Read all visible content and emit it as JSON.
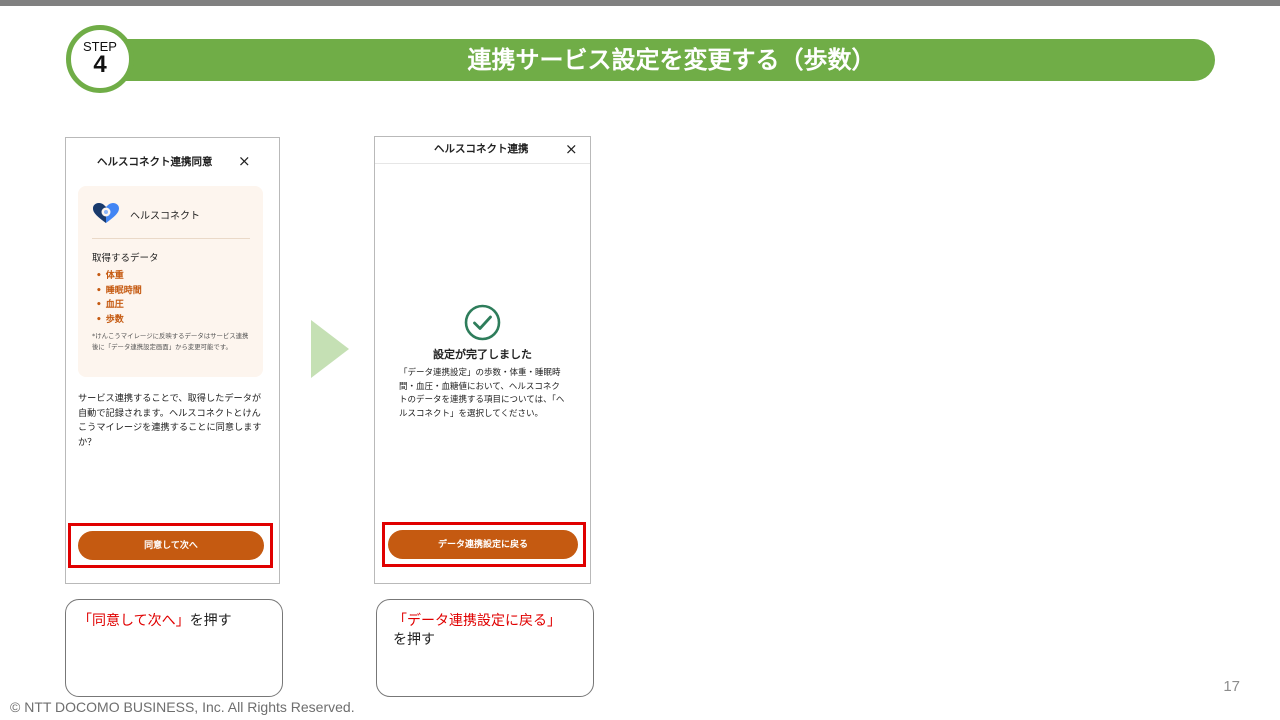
{
  "step": {
    "label": "STEP",
    "number": "4",
    "title": "連携サービス設定を変更する（歩数）"
  },
  "screen1": {
    "header_title": "ヘルスコネクト連携同意",
    "close": "×",
    "service_name": "ヘルスコネクト",
    "data_heading": "取得するデータ",
    "data_items": [
      "体重",
      "睡眠時間",
      "血圧",
      "歩数"
    ],
    "note": "*けんこうマイレージに反映するデータはサービス連携後に「データ連携設定画面」から変更可能です。",
    "description": "サービス連携することで、取得したデータが自動で記録されます。ヘルスコネクトとけんこうマイレージを連携することに同意しますか？",
    "button_label": "同意して次へ"
  },
  "screen2": {
    "header_title": "ヘルスコネクト連携",
    "close": "×",
    "done_title": "設定が完了しました",
    "description": "「データ連携設定」の歩数・体重・睡眠時間・血圧・血糖値において、ヘルスコネクトのデータを連携する項目については、「ヘルスコネクト」を選択してください。",
    "button_label": "データ連携設定に戻る"
  },
  "callouts": {
    "c1_red": "「同意して次へ」",
    "c1_black": "を押す",
    "c2_red": "「データ連携設定に戻る」",
    "c2_black": "を押す"
  },
  "footer": {
    "page_number": "17",
    "copyright": "© NTT DOCOMO BUSINESS, Inc. All Rights Reserved."
  },
  "colors": {
    "step_green": "#70ad47",
    "button_orange": "#c55a11",
    "highlight_red": "#e00000",
    "arrow_green": "#c5e0b4",
    "check_green": "#2e7d5b"
  }
}
